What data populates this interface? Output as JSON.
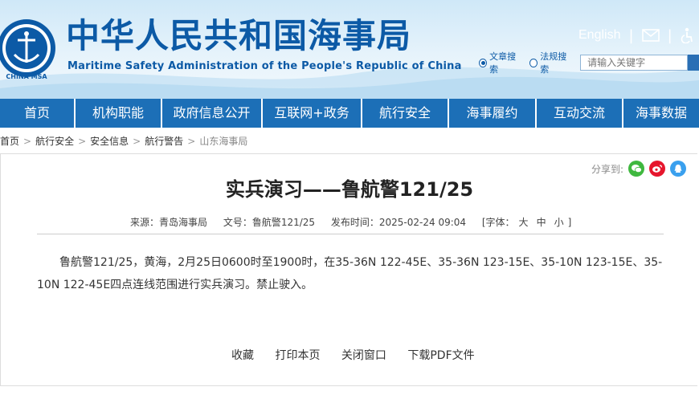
{
  "header": {
    "title_cn": "中华人民共和国海事局",
    "title_en": "Maritime Safety Administration of the People's Republic of China",
    "logo_text": "CHINA MSA",
    "lang_link": "English",
    "radios": [
      {
        "label": "文章搜索",
        "selected": true
      },
      {
        "label": "法规搜索",
        "selected": false
      }
    ],
    "search_placeholder": "请输入关键字"
  },
  "nav": {
    "items": [
      "首页",
      "机构职能",
      "政府信息公开",
      "互联网+政务",
      "航行安全",
      "海事履约",
      "互动交流",
      "海事数据"
    ]
  },
  "breadcrumb": {
    "items": [
      "首页",
      "航行安全",
      "安全信息",
      "航行警告"
    ],
    "current": "山东海事局"
  },
  "share": {
    "label": "分享到:"
  },
  "article": {
    "title": "实兵演习——鲁航警121/25",
    "source": "来源：青岛海事局",
    "doc_no": "文号：鲁航警121/25",
    "publish_time": "发布时间：2025-02-24 09:04",
    "font_label": "[字体：",
    "font_sizes": [
      "大",
      "中",
      "小"
    ],
    "font_close": "]",
    "body": "鲁航警121/25，黄海，2月25日0600时至1900时，在35-36N 122-45E、35-36N 123-15E、35-10N 123-15E、35-10N 122-45E四点连线范围进行实兵演习。禁止驶入。"
  },
  "actions": [
    "收藏",
    "打印本页",
    "关闭窗口",
    "下载PDF文件"
  ],
  "colors": {
    "brand_blue": "#0c5aa6",
    "nav_blue": "#1c6fb7",
    "wechat": "#3fb83f",
    "weibo": "#e6162d",
    "qq": "#3aa0ee"
  }
}
